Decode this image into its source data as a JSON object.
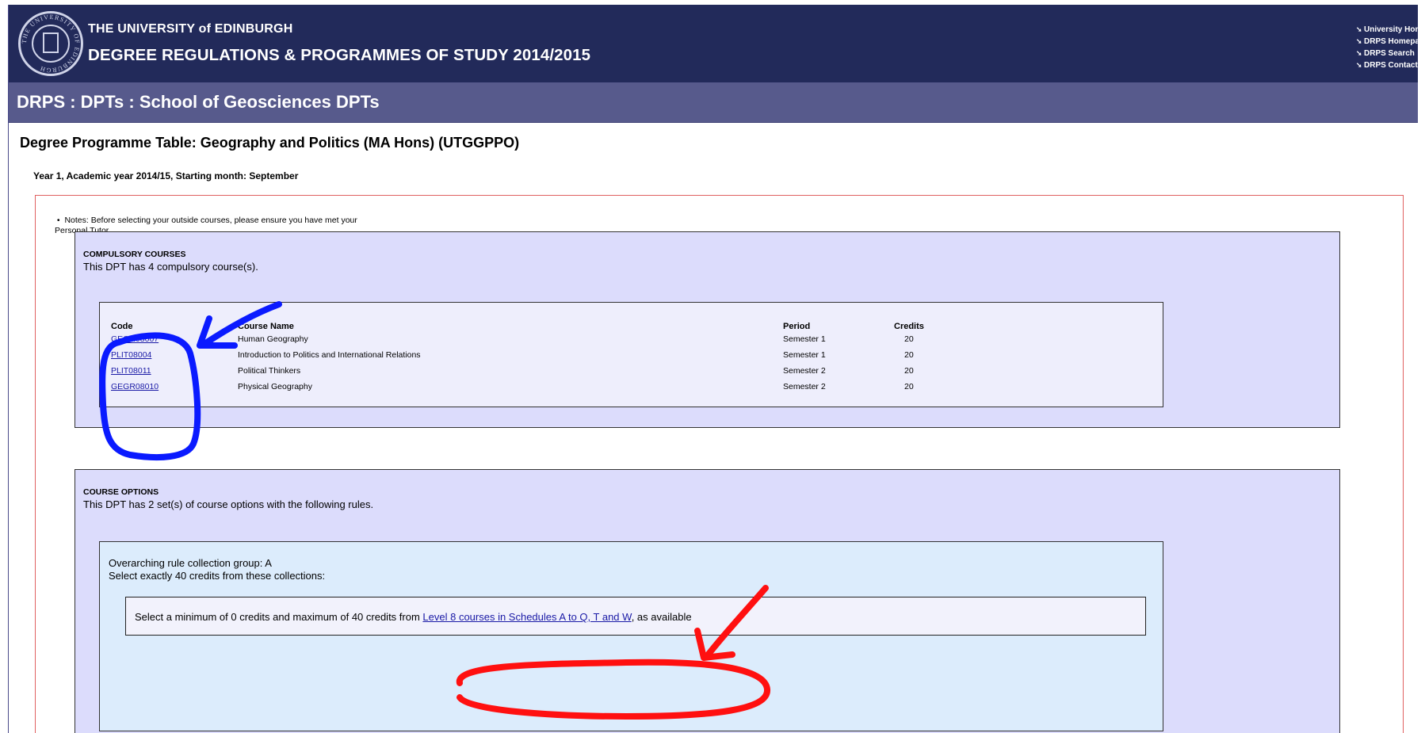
{
  "header": {
    "university": "THE UNIVERSITY of EDINBURGH",
    "title": "DEGREE REGULATIONS & PROGRAMMES OF STUDY 2014/2015",
    "crest_text": "THE UNIVERSITY OF EDINBURGH",
    "links": [
      "University Home",
      "DRPS Homepage",
      "DRPS Search",
      "DRPS Contact"
    ]
  },
  "breadcrumb": "DRPS : DPTs :  School of Geosciences DPTs",
  "page_title": "Degree Programme Table: Geography and Politics (MA Hons) (UTGGPPO)",
  "year_line": "Year 1, Academic year 2014/15, Starting month: September",
  "notes": {
    "line1": "Notes: Before selecting your outside courses, please ensure you have met your",
    "line2": "Personal Tutor."
  },
  "compulsory": {
    "heading": "COMPULSORY COURSES",
    "summary": "This DPT has 4 compulsory course(s).",
    "columns": {
      "code": "Code",
      "name": "Course Name",
      "period": "Period",
      "credits": "Credits"
    },
    "rows": [
      {
        "code": "GEGR08007",
        "name": "Human Geography",
        "period": "Semester 1",
        "credits": "20"
      },
      {
        "code": "PLIT08004",
        "name": "Introduction to Politics and International Relations",
        "period": "Semester 1",
        "credits": "20"
      },
      {
        "code": "PLIT08011",
        "name": "Political Thinkers",
        "period": "Semester 2",
        "credits": "20"
      },
      {
        "code": "GEGR08010",
        "name": "Physical Geography",
        "period": "Semester 2",
        "credits": "20"
      }
    ]
  },
  "options": {
    "heading": "COURSE OPTIONS",
    "summary": "This DPT has 2 set(s) of course options with the following rules.",
    "group_title": "Overarching rule collection group: A",
    "group_rule": "Select exactly 40 credits from these collections:",
    "rule_prefix": "Select a minimum of 0 credits and maximum of 40 credits from ",
    "rule_link": "Level 8 courses in Schedules A to Q, T and W",
    "rule_suffix": ", as available"
  },
  "annotations": {
    "blue": "#0a1aff",
    "red": "#ff1010"
  }
}
